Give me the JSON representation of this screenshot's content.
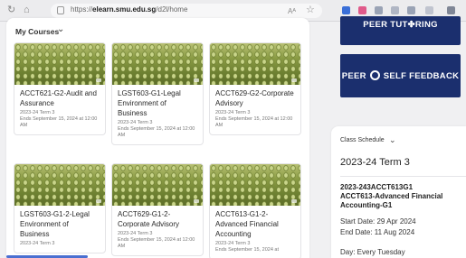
{
  "browser": {
    "url_prefix": "https://",
    "url_domain": "elearn.smu.edu.sg",
    "url_path": "/d2l/home",
    "aa_label": "Aᴬ"
  },
  "my_courses": {
    "title": "My Courses",
    "courses": [
      {
        "title": "ACCT621-G2-Audit and Assurance",
        "term": "2023-24 Term 3",
        "ends": "Ends September 15, 2024 at 12:00 AM"
      },
      {
        "title": "LGST603-G1-Legal Environment of Business",
        "term": "2023-24 Term 3",
        "ends": "Ends September 15, 2024 at 12:00 AM"
      },
      {
        "title": "ACCT629-G2-Corporate Advisory",
        "term": "2023-24 Term 3",
        "ends": "Ends September 15, 2024 at 12:00 AM"
      },
      {
        "title": "LGST603-G1-2-Legal Environment of Business",
        "term": "2023-24 Term 3",
        "ends": ""
      },
      {
        "title": "ACCT629-G1-2-Corporate Advisory",
        "term": "2023-24 Term 3",
        "ends": "Ends September 15, 2024 at 12:00 AM"
      },
      {
        "title": "ACCT613-G1-2-Advanced Financial Accounting",
        "term": "2023-24 Term 3",
        "ends": "Ends September 15, 2024 at"
      }
    ]
  },
  "banners": {
    "peer_tutoring": "PEER TUT✤RING",
    "peer_self_feedback_a": "PEER",
    "peer_self_feedback_b": "SELF FEEDBACK"
  },
  "schedule": {
    "title": "Class Schedule",
    "term": "2023-24 Term 3",
    "course_code": "2023-243ACCT613G1",
    "course_name": "ACCT613-Advanced Financial Accounting-G1",
    "start": "Start Date: 29 Apr 2024",
    "end": "End Date: 11 Aug 2024",
    "day": "Day: Every Tuesday"
  },
  "colors": {
    "banner_bg": "#1b2f6e",
    "scroll_accent": "#4a6fd1"
  }
}
